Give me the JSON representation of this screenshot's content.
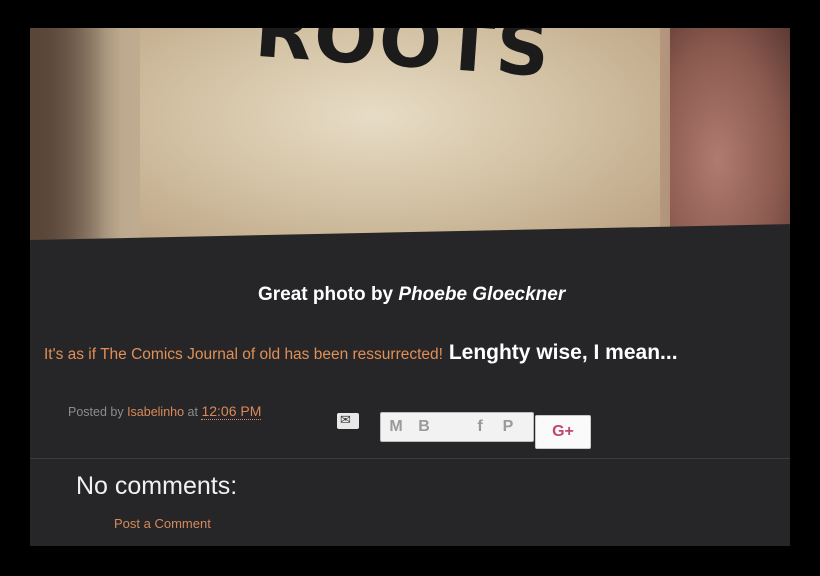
{
  "post": {
    "shirt_text": "ROOTS",
    "caption_prefix": "Great photo by ",
    "caption_author": "Phoebe Gloeckner",
    "body_orange": "It's as if The Comics Journal of old has been ressurrected!",
    "body_white": " Lenghty wise, I mean..."
  },
  "footer": {
    "posted_by_label": "Posted by ",
    "author": "Isabelinho",
    "at_label": " at ",
    "time": "12:06 PM"
  },
  "share": {
    "email_icon": "envelope-arrow-icon",
    "icons": [
      "gmail-icon",
      "blogger-icon",
      "twitter-icon",
      "facebook-icon",
      "pinterest-icon"
    ],
    "gmail_glyph": "M",
    "blogger_glyph": "B",
    "facebook_glyph": "f",
    "pinterest_glyph": "P",
    "gplus_label": "G+"
  },
  "comments": {
    "title": "No comments:",
    "post_comment_link": "Post a Comment"
  },
  "colors": {
    "background": "#262628",
    "accent_orange": "#e08f57",
    "text_white": "#ffffff",
    "muted": "#8c8c8c"
  }
}
